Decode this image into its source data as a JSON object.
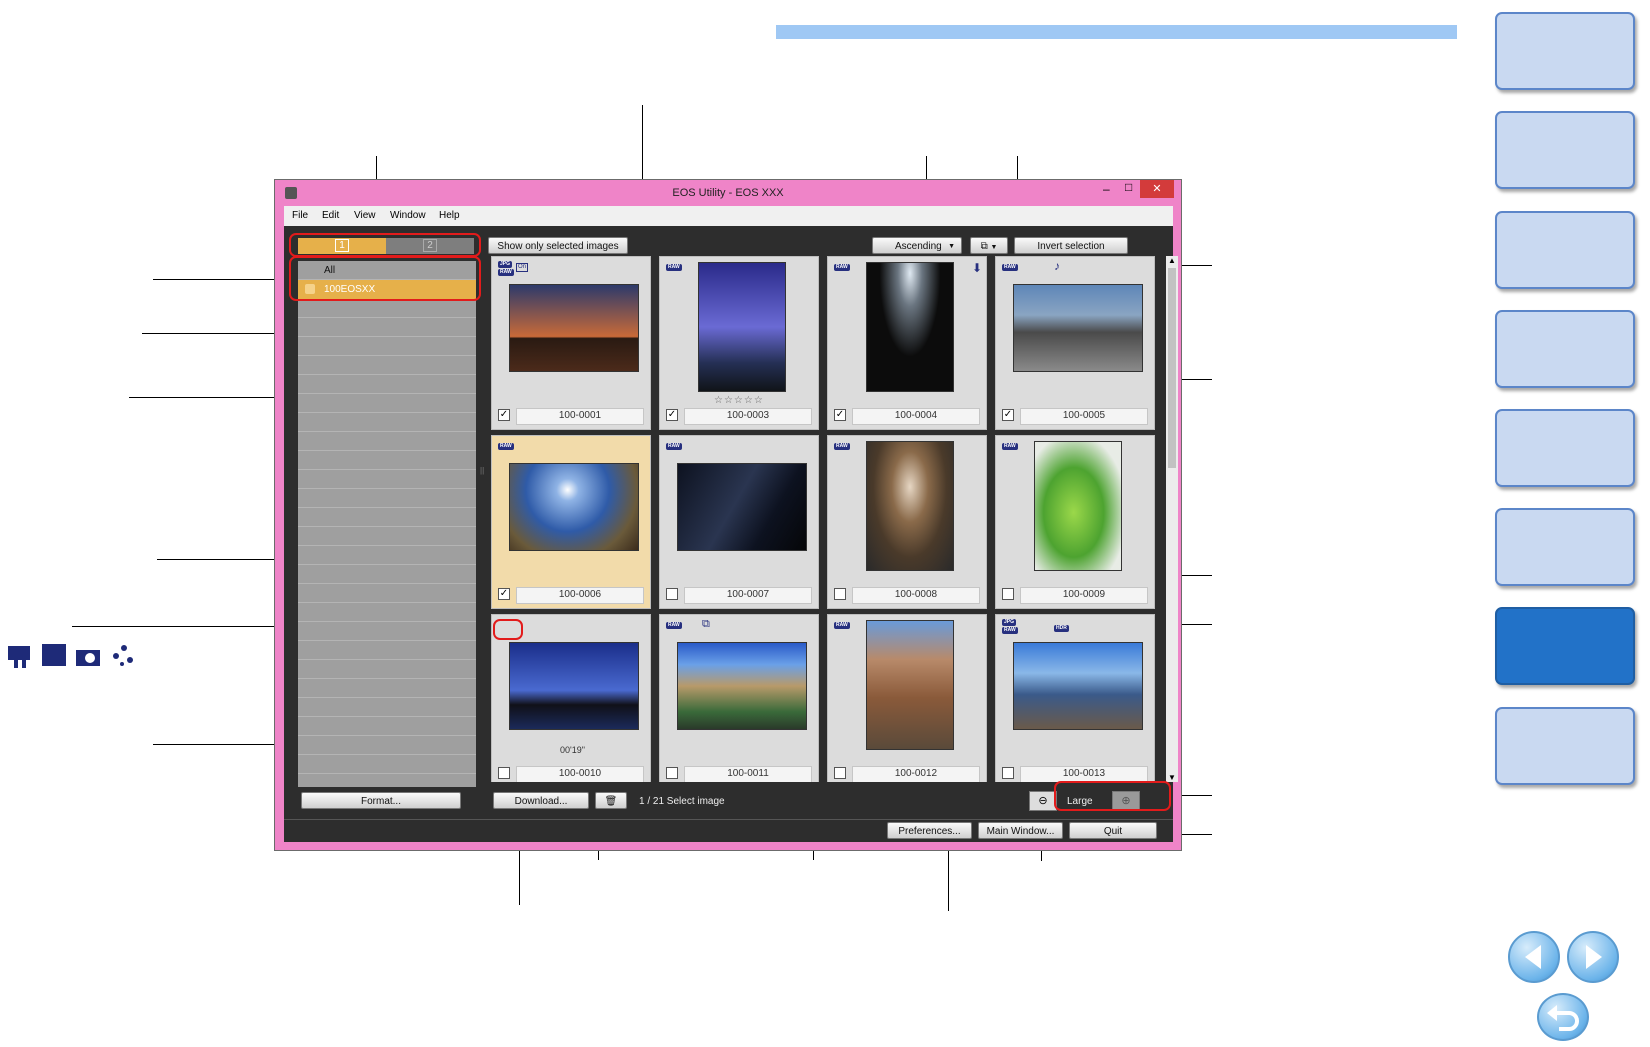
{
  "window": {
    "title": "EOS Utility -  EOS XXX"
  },
  "menu": {
    "file": "File",
    "edit": "Edit",
    "view": "View",
    "window": "Window",
    "help": "Help"
  },
  "toolbar": {
    "show_selected": "Show only selected images",
    "sort_order": "Ascending",
    "invert_selection": "Invert selection"
  },
  "card_tabs": [
    "1",
    "2"
  ],
  "folders": [
    "All",
    "100EOSXX"
  ],
  "images": [
    {
      "name": "100-0001",
      "checked": true
    },
    {
      "name": "100-0003",
      "checked": true
    },
    {
      "name": "100-0004",
      "checked": true
    },
    {
      "name": "100-0005",
      "checked": true
    },
    {
      "name": "100-0006",
      "checked": true
    },
    {
      "name": "100-0007",
      "checked": false
    },
    {
      "name": "100-0008",
      "checked": false
    },
    {
      "name": "100-0009",
      "checked": false
    },
    {
      "name": "100-0010",
      "checked": false
    },
    {
      "name": "100-0011",
      "checked": false
    },
    {
      "name": "100-0012",
      "checked": false
    },
    {
      "name": "100-0013",
      "checked": false
    }
  ],
  "movie_duration": "00'19\"",
  "badges": {
    "raw": "RAW",
    "jpg": "JPG",
    "on": "On",
    "hdr": "HDR",
    "music": "♪"
  },
  "bottom": {
    "format": "Format...",
    "download": "Download...",
    "selection_count": "1 / 21 Select image",
    "zoom_label": "Large"
  },
  "footer": {
    "preferences": "Preferences...",
    "main_window": "Main Window...",
    "quit": "Quit"
  },
  "colors": {
    "window_frame": "#ef84c8",
    "selected_cell": "#f2dbaa",
    "tab_active": "#e6b04a",
    "header_bar": "#9fc8f4",
    "nav_active": "#2272c8"
  }
}
